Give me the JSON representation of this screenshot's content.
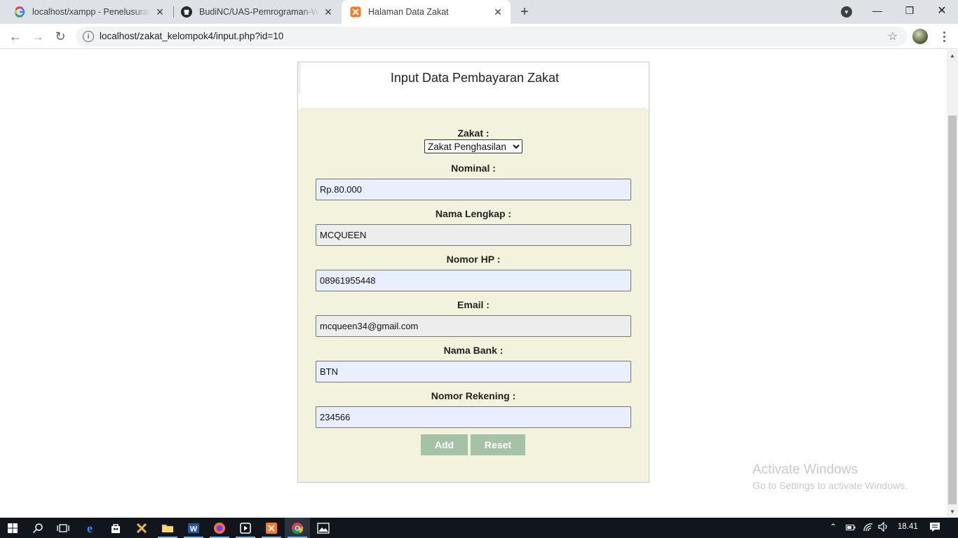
{
  "browser": {
    "tabs": [
      {
        "title": "localhost/xampp - Penelusuran Google",
        "icon": "google-icon",
        "active": false
      },
      {
        "title": "BudiNC/UAS-Pemrograman-Web",
        "icon": "github-icon",
        "active": false
      },
      {
        "title": "Halaman Data Zakat",
        "icon": "xampp-icon",
        "active": true
      }
    ],
    "url": "localhost/zakat_kelompok4/input.php?id=10"
  },
  "page": {
    "title": "Input Data Pembayaran Zakat",
    "form": {
      "zakat_label": "Zakat :",
      "zakat_selected": "Zakat Penghasilan",
      "nominal_label": "Nominal :",
      "nominal_value": "Rp.80.000",
      "nama_label": "Nama Lengkap :",
      "nama_value": "MCQUEEN",
      "hp_label": "Nomor HP :",
      "hp_value": "08961955448",
      "email_label": "Email :",
      "email_value": "mcqueen34@gmail.com",
      "bank_label": "Nama Bank :",
      "bank_value": "BTN",
      "rekening_label": "Nomor Rekening :",
      "rekening_value": "234566",
      "add_label": "Add",
      "reset_label": "Reset"
    }
  },
  "watermark": {
    "line1": "Activate Windows",
    "line2": "Go to Settings to activate Windows."
  },
  "taskbar": {
    "clock": "18.41",
    "apps": [
      "start-icon",
      "search-icon",
      "task-view-icon",
      "edge-icon",
      "store-icon",
      "xampp-control-icon",
      "file-explorer-icon",
      "word-icon",
      "firefox-icon",
      "media-player-icon",
      "xampp-icon",
      "chrome-icon",
      "photos-icon"
    ]
  },
  "colors": {
    "form_bg": "#f3f3dd",
    "button_bg": "#a6c2a6",
    "autofill_bg": "#e8f0fe"
  }
}
